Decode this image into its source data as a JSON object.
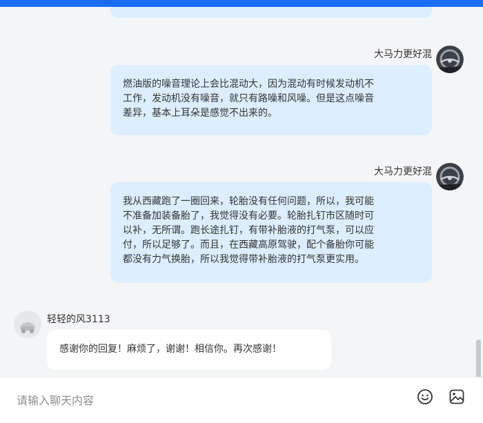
{
  "messages": [
    {
      "sender": "大马力更好混",
      "lines": [
        "燃油版的噪音理论上会比混动大，因为混动有时候发动机不",
        "工作，发动机没有噪音，就只有路噪和风噪。但是这点噪音",
        "差异，基本上耳朵是感觉不出来的。"
      ]
    },
    {
      "sender": "大马力更好混",
      "lines": [
        "我从西藏跑了一圈回来，轮胎没有任何问题，所以，我可能",
        "不准备加装备胎了，我觉得没有必要。轮胎扎钉市区随时可",
        "以补，无所谓。跑长途扎钉，有带补胎液的打气泵，可以应",
        "付，所以足够了。而且，在西藏高原驾驶，配个备胎你可能",
        "都没有力气换胎，所以我觉得带补胎液的打气泵更实用。"
      ]
    },
    {
      "sender": "轻轻的风3113",
      "text": "感谢你的回复！麻烦了，谢谢！相信你。再次感谢！"
    }
  ],
  "input": {
    "placeholder": "请输入聊天内容"
  },
  "icons": {
    "emoji": "emoji-icon",
    "image": "image-icon"
  },
  "colors": {
    "top_bar": "#1a6cf3",
    "outgoing_bubble": "#dceeff",
    "incoming_bubble": "#ffffff",
    "background": "#f4f5f7"
  }
}
